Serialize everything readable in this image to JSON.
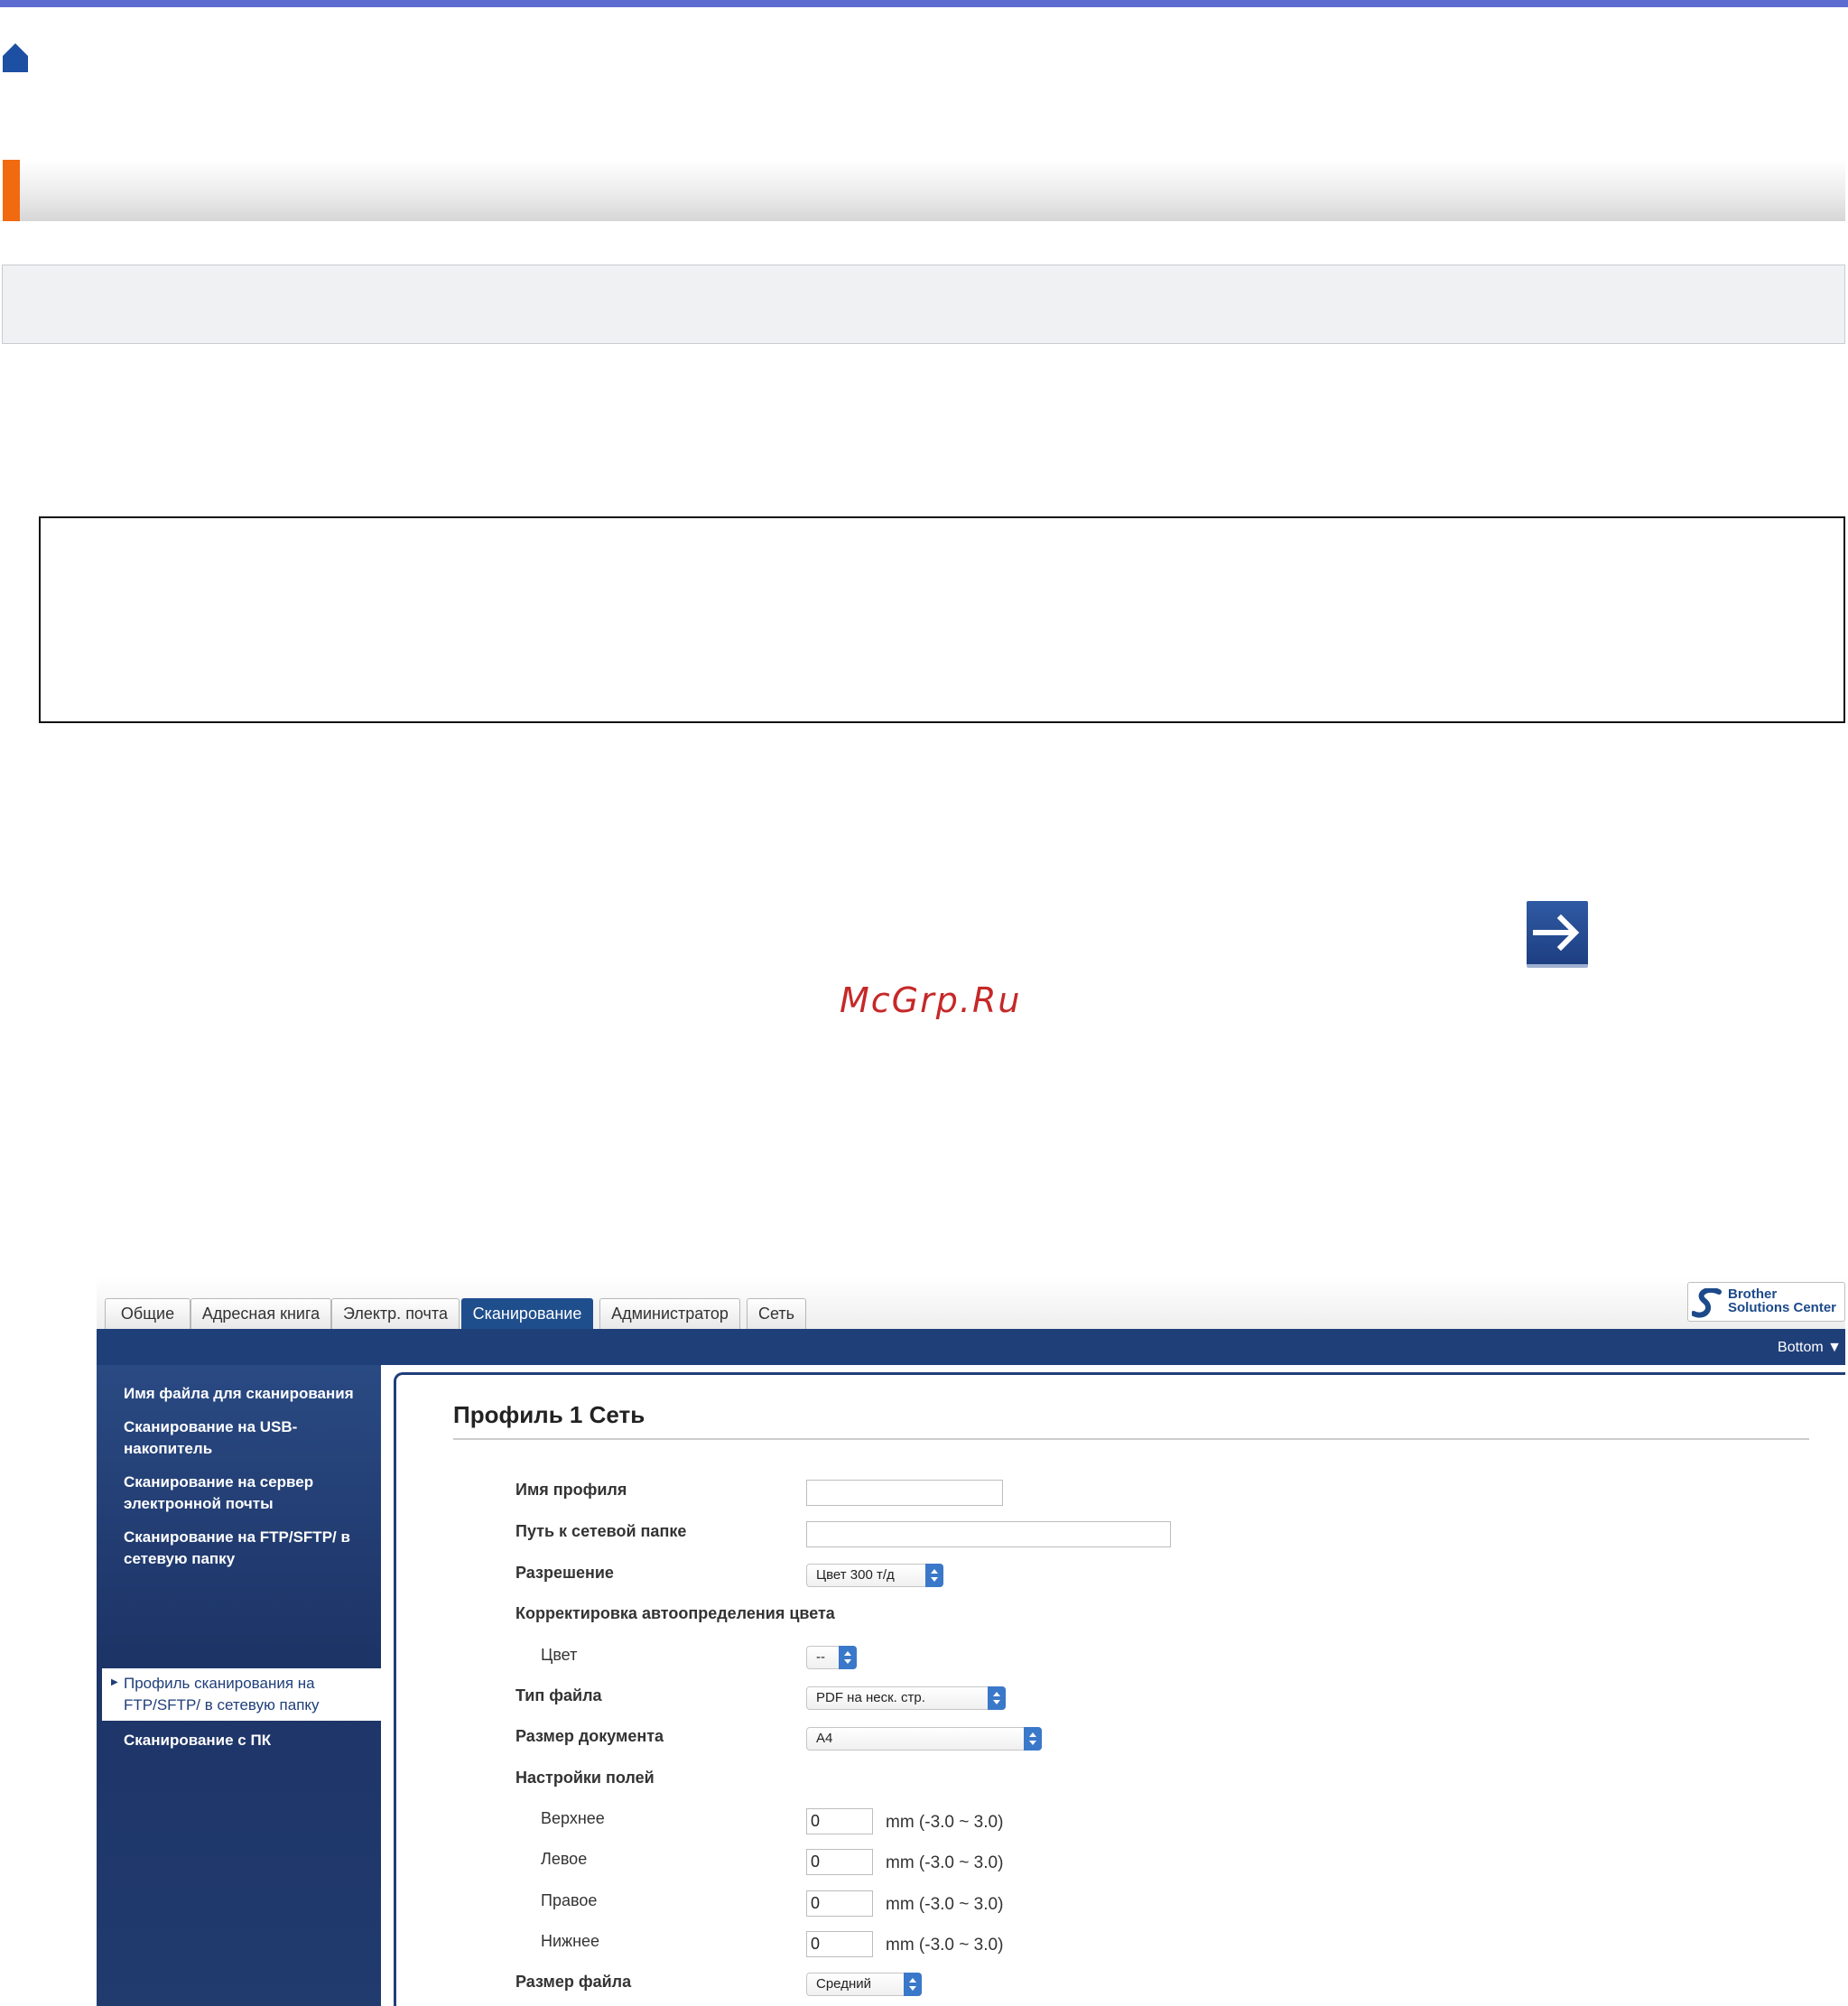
{
  "watermark": "McGrp.Ru",
  "tabs": [
    {
      "label": "Общие"
    },
    {
      "label": "Адресная книга"
    },
    {
      "label": "Электр. почта"
    },
    {
      "label": "Сканирование"
    },
    {
      "label": "Администратор"
    },
    {
      "label": "Сеть"
    }
  ],
  "active_tab": "Сканирование",
  "logo": {
    "line1": "Brother",
    "line2": "Solutions Center"
  },
  "bottom_link": "Bottom ▼",
  "sidebar": {
    "items": [
      {
        "label": "Имя файла для сканирования"
      },
      {
        "label": "Сканирование на USB-накопитель"
      },
      {
        "label": "Сканирование на сервер электронной почты"
      },
      {
        "label": "Сканирование на FTP/SFTP/ в сетевую папку"
      },
      {
        "label": "Профиль сканирования на FTP/SFTP/ в сетевую папку"
      },
      {
        "label": "Сканирование с ПК"
      }
    ],
    "active_index": 4
  },
  "main": {
    "title": "Профиль 1 Сеть",
    "labels": {
      "profile_name": "Имя профиля",
      "network_path": "Путь к сетевой папке",
      "resolution": "Разрешение",
      "auto_color": "Корректировка автоопределения цвета",
      "color": "Цвет",
      "file_type": "Тип файла",
      "doc_size": "Размер документа",
      "margins": "Настройки полей",
      "top": "Верхнее",
      "left": "Левое",
      "right": "Правое",
      "bottom": "Нижнее",
      "file_size": "Размер файла"
    },
    "values": {
      "profile_name": "",
      "network_path": "",
      "resolution": "Цвет 300 т/д",
      "color": "--",
      "file_type": "PDF на неск. стр.",
      "doc_size": "A4",
      "margin_top": "0",
      "margin_left": "0",
      "margin_right": "0",
      "margin_bottom": "0",
      "file_size": "Средний"
    },
    "margin_unit": "mm (-3.0 ~ 3.0)"
  }
}
